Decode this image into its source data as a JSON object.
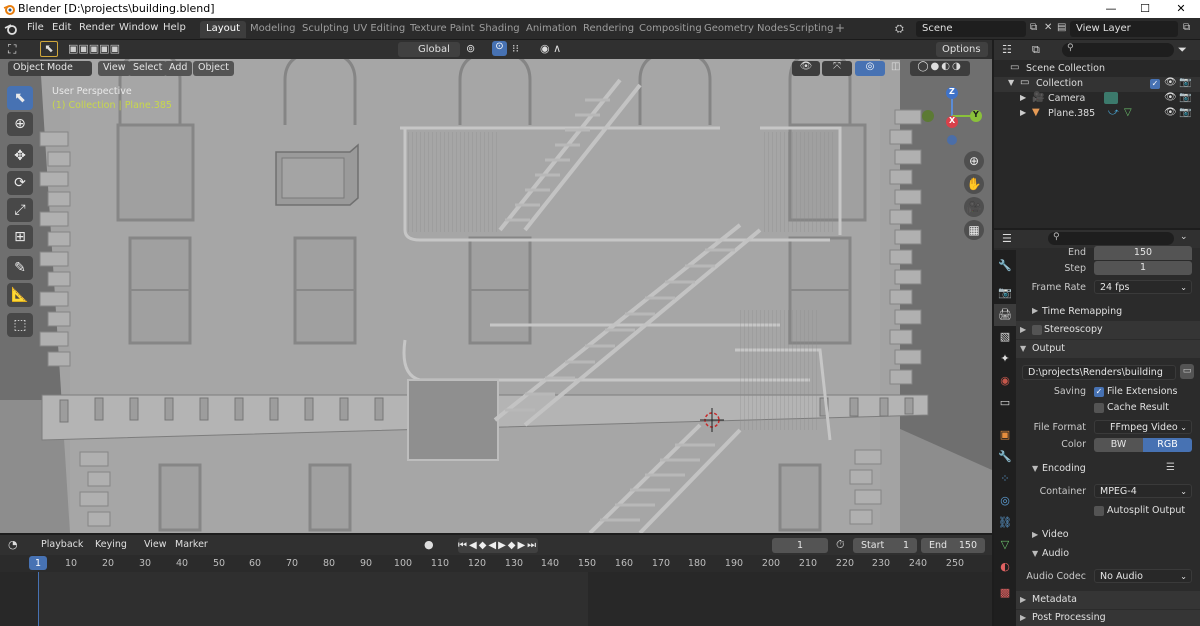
{
  "titlebar": {
    "title": "Blender [D:\\projects\\building.blend]",
    "minimize": "—",
    "maximize": "☐",
    "close": "✕"
  },
  "menubar": {
    "menus": [
      "File",
      "Edit",
      "Render",
      "Window",
      "Help"
    ],
    "workspaces": [
      "Layout",
      "Modeling",
      "Sculpting",
      "UV Editing",
      "Texture Paint",
      "Shading",
      "Animation",
      "Rendering",
      "Compositing",
      "Geometry Nodes",
      "Scripting"
    ],
    "active_workspace": "Layout",
    "add_tab": "+",
    "scene": "Scene",
    "view_layer": "View Layer"
  },
  "viewport": {
    "mode": "Object Mode",
    "menus": [
      "View",
      "Select",
      "Add",
      "Object"
    ],
    "transform_orientation": "Global",
    "options": "Options",
    "overlay_title": "User Perspective",
    "overlay_sub": "(1) Collection | Plane.385",
    "gizmo": {
      "x": "X",
      "y": "Y",
      "z": "Z"
    }
  },
  "outliner": {
    "search_placeholder": "",
    "rows": [
      {
        "label": "Scene Collection",
        "indent": 0
      },
      {
        "label": "Collection",
        "indent": 1
      },
      {
        "label": "Camera",
        "indent": 2
      },
      {
        "label": "Plane.385",
        "indent": 2
      }
    ]
  },
  "properties": {
    "end_label": "End",
    "end_value": "150",
    "step_label": "Step",
    "step_value": "1",
    "frame_rate_label": "Frame Rate",
    "frame_rate_value": "24 fps",
    "time_remapping": "Time Remapping",
    "stereoscopy": "Stereoscopy",
    "output": "Output",
    "output_path": "D:\\projects\\Renders\\building",
    "saving_label": "Saving",
    "file_extensions": "File Extensions",
    "cache_result": "Cache Result",
    "file_format_label": "File Format",
    "file_format_value": "FFmpeg Video",
    "color_label": "Color",
    "color_bw": "BW",
    "color_rgb": "RGB",
    "encoding": "Encoding",
    "container_label": "Container",
    "container_value": "MPEG-4",
    "autosplit": "Autosplit Output",
    "video": "Video",
    "audio": "Audio",
    "audio_codec_label": "Audio Codec",
    "audio_codec_value": "No Audio",
    "metadata": "Metadata",
    "post_processing": "Post Processing"
  },
  "timeline": {
    "menus": [
      "Playback",
      "Keying",
      "View",
      "Marker"
    ],
    "current_frame": "1",
    "start_label": "Start",
    "start_value": "1",
    "end_label": "End",
    "end_value": "150",
    "ruler": [
      "1",
      "10",
      "20",
      "30",
      "40",
      "50",
      "60",
      "70",
      "80",
      "90",
      "100",
      "110",
      "120",
      "130",
      "140",
      "150",
      "160",
      "170",
      "180",
      "190",
      "200",
      "210",
      "220",
      "230",
      "240",
      "250"
    ]
  },
  "colors": {
    "accent": "#4772b3",
    "active_frame": "#4772b3",
    "object_text": "#c8d84a"
  }
}
